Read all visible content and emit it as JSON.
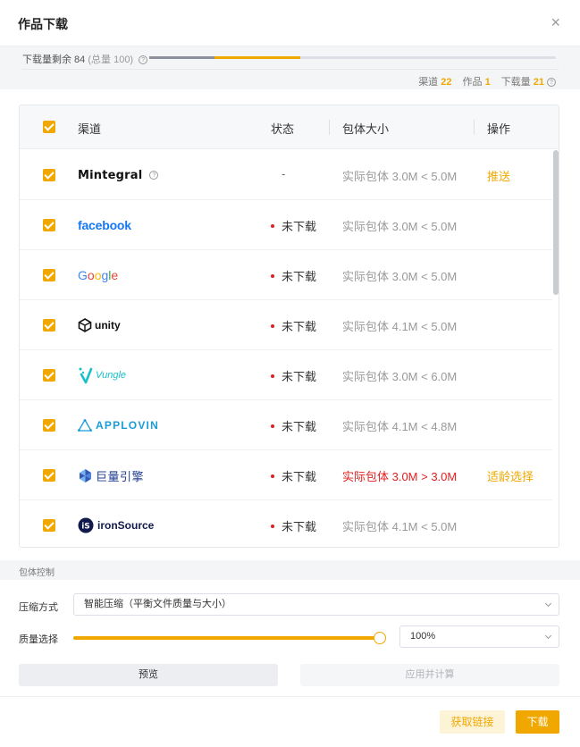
{
  "dialog": {
    "title": "作品下载",
    "close_glyph": "×"
  },
  "quota": {
    "label": "下载量剩余 84",
    "total": "(总量 100)",
    "bar": {
      "used_fraction": 0.16,
      "selected_fraction": 0.21
    }
  },
  "stats": {
    "channels_label": "渠道",
    "channels_value": "22",
    "works_label": "作品",
    "works_value": "1",
    "downloads_label": "下载量",
    "downloads_value": "21"
  },
  "table": {
    "headers": {
      "channel": "渠道",
      "status": "状态",
      "size": "包体大小",
      "action": "操作"
    },
    "rows": [
      {
        "channel": "Mintegral",
        "logo": "mintegral-logo",
        "status": "-",
        "size": "实际包体 3.0M < 5.0M",
        "size_warn": false,
        "action": "推送"
      },
      {
        "channel": "facebook",
        "logo": "facebook-logo",
        "status": "未下载",
        "size": "实际包体 3.0M < 5.0M",
        "size_warn": false,
        "action": ""
      },
      {
        "channel": "Google",
        "logo": "google-logo",
        "status": "未下载",
        "size": "实际包体 3.0M < 5.0M",
        "size_warn": false,
        "action": ""
      },
      {
        "channel": "unity",
        "logo": "unity-logo",
        "status": "未下载",
        "size": "实际包体 4.1M < 5.0M",
        "size_warn": false,
        "action": ""
      },
      {
        "channel": "Vungle",
        "logo": "vungle-logo",
        "status": "未下载",
        "size": "实际包体 3.0M < 6.0M",
        "size_warn": false,
        "action": ""
      },
      {
        "channel": "APPLOVIN",
        "logo": "applovin-logo",
        "status": "未下载",
        "size": "实际包体 4.1M < 4.8M",
        "size_warn": false,
        "action": ""
      },
      {
        "channel": "巨量引擎",
        "logo": "ocean-engine-logo",
        "status": "未下载",
        "size": "实际包体 3.0M > 3.0M",
        "size_warn": true,
        "action": "适龄选择"
      },
      {
        "channel": "ironSource",
        "logo": "ironsource-logo",
        "status": "未下载",
        "size": "实际包体 4.1M < 5.0M",
        "size_warn": false,
        "action": ""
      }
    ]
  },
  "package_control": {
    "section_label": "包体控制",
    "compression_label": "压缩方式",
    "compression_value": "智能压缩（平衡文件质量与大小）",
    "quality_label": "质量选择",
    "quality_percent": 100,
    "quality_value": "100%",
    "preview_label": "预览",
    "apply_label": "应用并计算"
  },
  "footer": {
    "get_link_label": "获取链接",
    "download_label": "下载"
  },
  "colors": {
    "accent": "#f0a800",
    "warn": "#e02020",
    "facebook": "#1877f2"
  }
}
